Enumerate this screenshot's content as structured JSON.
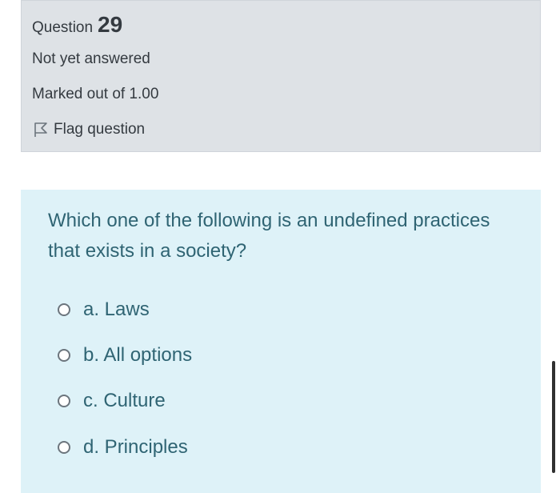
{
  "question": {
    "label": "Question",
    "number": "29",
    "state": "Not yet answered",
    "grade": "Marked out of 1.00",
    "flag_label": "Flag question",
    "flag_icon": "flag-outline-icon"
  },
  "prompt": {
    "text": "Which one of the following is an undefined practices that exists in a society?"
  },
  "options": [
    {
      "label": "a. Laws",
      "selected": false
    },
    {
      "label": "b. All options",
      "selected": false
    },
    {
      "label": "c. Culture",
      "selected": false
    },
    {
      "label": "d. Principles",
      "selected": false
    }
  ],
  "colors": {
    "info_bg": "#dee2e6",
    "content_bg": "#def2f8",
    "question_text": "#2f6473",
    "info_text": "#343a40"
  }
}
